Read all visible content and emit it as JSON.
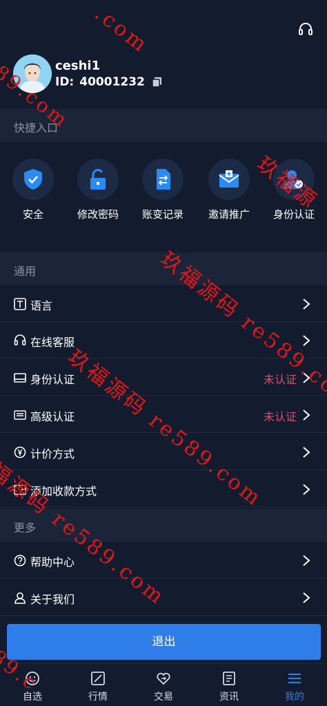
{
  "header": {
    "username": "ceshi1",
    "uid_prefix": "ID:",
    "uid": "40001232"
  },
  "quick_entry": {
    "title": "快捷入口",
    "items": [
      {
        "label": "安全",
        "icon": "shield-check-icon"
      },
      {
        "label": "修改密码",
        "icon": "unlock-icon"
      },
      {
        "label": "账变记录",
        "icon": "file-transfer-icon"
      },
      {
        "label": "邀请推广",
        "icon": "envelope-icon"
      },
      {
        "label": "身份认证",
        "icon": "user-verify-icon"
      }
    ]
  },
  "general": {
    "title": "通用",
    "items": [
      {
        "label": "语言",
        "icon": "text-box-icon",
        "status": ""
      },
      {
        "label": "在线客服",
        "icon": "headset-icon",
        "status": ""
      },
      {
        "label": "身份认证",
        "icon": "id-card-icon",
        "status": "未认证"
      },
      {
        "label": "高级认证",
        "icon": "id-card-advanced-icon",
        "status": "未认证"
      },
      {
        "label": "计价方式",
        "icon": "yen-circle-icon",
        "status": ""
      },
      {
        "label": "添加收款方式",
        "icon": "wallet-icon",
        "status": ""
      }
    ]
  },
  "more": {
    "title": "更多",
    "items": [
      {
        "label": "帮助中心",
        "icon": "question-circle-icon"
      },
      {
        "label": "关于我们",
        "icon": "user-icon"
      }
    ]
  },
  "logout_label": "退出",
  "tabs": [
    {
      "label": "自选",
      "icon": "smile-icon",
      "active": false
    },
    {
      "label": "行情",
      "icon": "chart-square-icon",
      "active": false
    },
    {
      "label": "交易",
      "icon": "exchange-heart-icon",
      "active": false
    },
    {
      "label": "资讯",
      "icon": "news-icon",
      "active": false
    },
    {
      "label": "我的",
      "icon": "menu-lines-icon",
      "active": true
    }
  ],
  "watermark": {
    "text_a": "玖福源码 re589.com",
    "text_b": "玖福源码 re589.com",
    "text_c": "福源码 re589.com",
    "text_d": ".com",
    "text_e": "89.com",
    "text_f": "玖福源",
    "text_g": "89.c"
  },
  "colors": {
    "background": "#131c2f",
    "section": "#1b2438",
    "accent": "#2f7de8",
    "status_red": "#e04a6b",
    "watermark": "#e01818"
  }
}
